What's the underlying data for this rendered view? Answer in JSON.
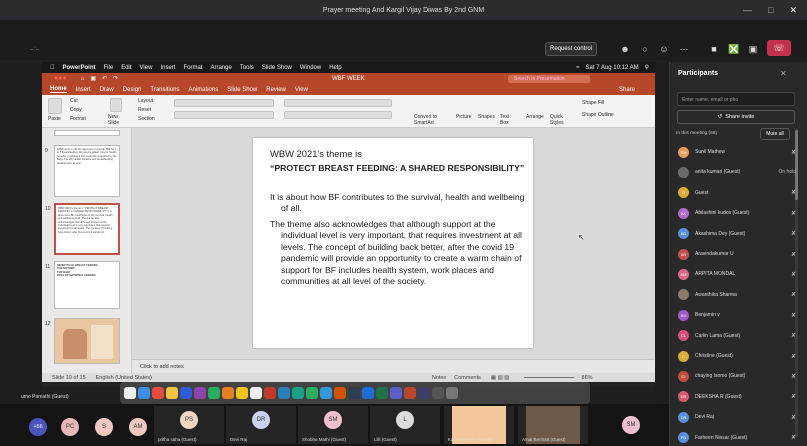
{
  "teams": {
    "window_title": "Prayer meeting And Kargil Vijay Diwas By 2nd GNM",
    "request_control": "Request control",
    "time_label": "--:--"
  },
  "mac": {
    "menu": [
      "PowerPoint",
      "File",
      "Edit",
      "View",
      "Insert",
      "Format",
      "Arrange",
      "Tools",
      "Slide Show",
      "Window",
      "Help"
    ],
    "clock": "Sat 7 Aug  10:12 AM",
    "doc_title": "WBF WEEK",
    "search_placeholder": "Search in Presentation",
    "tabs": [
      "Home",
      "Insert",
      "Draw",
      "Design",
      "Transitions",
      "Animations",
      "Slide Show",
      "Review",
      "View"
    ],
    "share": "Share",
    "ribbon": {
      "paste": "Paste",
      "cut": "Cut",
      "copy": "Copy",
      "format": "Format",
      "new_slide": "New Slide",
      "layout": "Layout",
      "reset": "Reset",
      "section": "Section",
      "convert": "Convert to SmartArt",
      "picture": "Picture",
      "shapes": "Shapes",
      "textbox": "Text Box",
      "arrange": "Arrange",
      "quick_styles": "Quick Styles",
      "shape_fill": "Shape Fill",
      "shape_outline": "Shape Outline"
    },
    "thumbs": [
      {
        "num": "9",
        "text": "WBW aims to call the agencies to provide TBF for 1 in 7 breastfeeding. All parents global, rural or health benefits, providing a free materials supported by the Baby Friendly Health Initiative and breastfeeding development as and."
      },
      {
        "num": "10",
        "text": "WBW 2021's theme is \"PROTECT BREAST FEEDING: A SHARED RESPONSIBILITY\" It is about how BF contributes to the survival, health and wellbeing of all. The theme also acknowledges that although support at the individual level is very important, that requires investment at all levels. The concept of building back better, after the covid 19 pandemic."
      },
      {
        "num": "11",
        "text": "BENEFITS OF BREAST FEEDING\nFOR MOTHER\nFOR BABY\nROLE OF MATERNAL FEEDING"
      },
      {
        "num": "12",
        "text": ""
      }
    ],
    "slide": {
      "title_line": "WBW 2021's theme is",
      "theme_line": "“PROTECT BREAST FEEDING: A SHARED RESPONSIBILITY”",
      "para1": "It is about how BF contributes to the survival, health and wellbeing of all.",
      "para2": "The theme also acknowledges that although support at the individual level is very important, that requires investment at all levels. The concept of building back better, after the covid 19 pandemic will provide an opportunity to create a warm chain of support for BF includes health system, work places and communities at all level of the society."
    },
    "notes_placeholder": "Click to add notes",
    "status": {
      "slide_of": "Slide 10 of 15",
      "lang": "English (United States)",
      "notes": "Notes",
      "comments": "Comments",
      "zoom": "86%"
    }
  },
  "participants": {
    "title": "Participants",
    "search_placeholder": "Enter name, email or pho",
    "share_invite": "Share invite",
    "section_label": "In this meeting (68)",
    "mute_all": "Mute all",
    "people": [
      {
        "initials": "SM",
        "name": "Sunil Mathew",
        "color": "#e89c5c",
        "status": ""
      },
      {
        "initials": "",
        "name": "anita kumari (Guest)",
        "color": "#6b6b6b",
        "status": "On hold"
      },
      {
        "initials": "G",
        "name": "Guest",
        "color": "#d9a93a",
        "status": ""
      },
      {
        "initials": "AK",
        "name": "Abilashini kudos (Guest)",
        "color": "#b46ac8",
        "status": ""
      },
      {
        "initials": "AD",
        "name": "Akashima Dey (Guest)",
        "color": "#5a8ed8",
        "status": ""
      },
      {
        "initials": "AR",
        "name": "Aravindakumar U",
        "color": "#c44f4f",
        "status": ""
      },
      {
        "initials": "AM",
        "name": "ARPITA MONDAL",
        "color": "#d86a8c",
        "status": ""
      },
      {
        "initials": "",
        "name": "Awanthika Sharma",
        "color": "#8c7a66",
        "status": ""
      },
      {
        "initials": "BV",
        "name": "Benjamin v",
        "color": "#9e5cc8",
        "status": ""
      },
      {
        "initials": "CL",
        "name": "Carlin Lama (Guest)",
        "color": "#d64f7a",
        "status": ""
      },
      {
        "initials": "C",
        "name": "Christine (Guest)",
        "color": "#d9a93a",
        "status": ""
      },
      {
        "initials": "CI",
        "name": "chaying Isomo (Guest)",
        "color": "#c0503e",
        "status": ""
      },
      {
        "initials": "DR",
        "name": "DEEKSHA R (Guest)",
        "color": "#d95a6e",
        "status": ""
      },
      {
        "initials": "DR",
        "name": "Devi Raj",
        "color": "#5a8ed8",
        "status": ""
      },
      {
        "initials": "FN",
        "name": "Farheen Nissar (Guest)",
        "color": "#5a8ed8",
        "status": ""
      }
    ]
  },
  "strip": {
    "presenter": "umo Pamathi (Guest)",
    "overflow": "+56",
    "small": [
      {
        "initials": "PC",
        "color": "#e6b8b8"
      },
      {
        "initials": "S",
        "color": "#f0c8c0"
      },
      {
        "initials": "AM",
        "color": "#f0c8c0"
      }
    ],
    "tiles": [
      {
        "initials": "PS",
        "name": "pritha saha (Guest)",
        "color": "#f2d6c2"
      },
      {
        "initials": "DR",
        "name": "Devi Raj",
        "color": "#c8d4ee"
      },
      {
        "initials": "SM",
        "name": "Shobha Mathi (Guest)",
        "color": "#f0c0cc"
      },
      {
        "initials": "L",
        "name": "Lilli (Guest)",
        "color": "#dcdcdc"
      },
      {
        "initials": "",
        "name": "Kamal Kapure (Guest)",
        "color": "#f3c79a"
      },
      {
        "initials": "",
        "name": "Amal Bermatt (Guest)",
        "color": "#6e5a4a"
      }
    ],
    "right_avatar": {
      "initials": "SM",
      "color": "#f0c0cc"
    }
  }
}
